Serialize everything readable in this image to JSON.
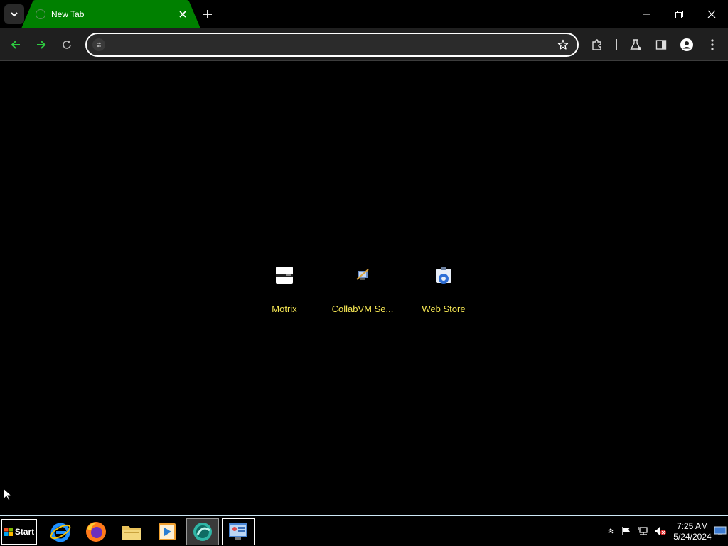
{
  "browser": {
    "tab": {
      "title": "New Tab"
    },
    "omnibox": {
      "value": "",
      "placeholder": ""
    }
  },
  "shortcuts": [
    {
      "label": "Motrix",
      "icon": "motrix-icon"
    },
    {
      "label": "CollabVM Se...",
      "icon": "collabvm-icon"
    },
    {
      "label": "Web Store",
      "icon": "web-store-icon"
    }
  ],
  "taskbar": {
    "start_label": "Start",
    "apps": [
      "internet-explorer-icon",
      "firefox-icon",
      "file-explorer-icon",
      "media-player-icon",
      "browser-icon",
      "control-panel-icon"
    ],
    "clock": {
      "time": "7:25 AM",
      "date": "5/24/2024"
    }
  },
  "colors": {
    "tab_active": "#008000",
    "nav_green": "#2ecc40",
    "shortcut_label": "#f5e653",
    "taskbar_border": "#cde8f6"
  }
}
